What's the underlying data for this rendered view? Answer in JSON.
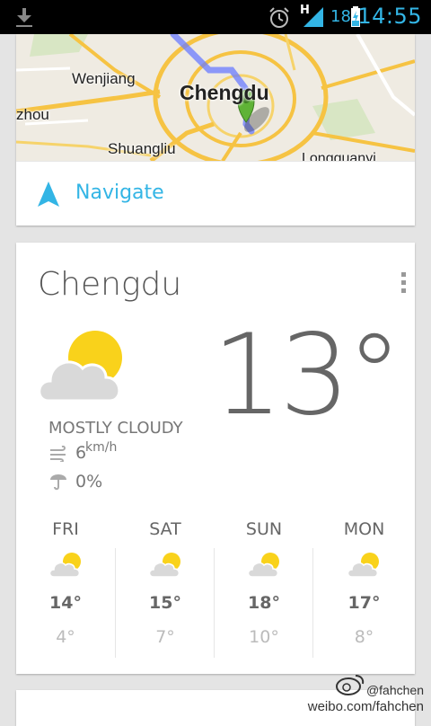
{
  "status_bar": {
    "network": "H",
    "battery": "18",
    "time": "14:55"
  },
  "map": {
    "labels": [
      "Wenjiang",
      "Chengdu",
      "zhou",
      "Shuangliu",
      "Longquanyi"
    ]
  },
  "navigate": {
    "label": "Navigate"
  },
  "weather": {
    "city": "Chengdu",
    "temperature": "13°",
    "condition": "MOSTLY CLOUDY",
    "wind_value": "6",
    "wind_unit": "km/h",
    "precipitation": "0%",
    "forecast": [
      {
        "day": "FRI",
        "high": "14°",
        "low": "4°"
      },
      {
        "day": "SAT",
        "high": "15°",
        "low": "7°"
      },
      {
        "day": "SUN",
        "high": "18°",
        "low": "10°"
      },
      {
        "day": "MON",
        "high": "17°",
        "low": "8°"
      }
    ]
  },
  "watermark": {
    "handle": "@fahchen",
    "url": "weibo.com/fahchen"
  },
  "icons": {
    "download": "download-icon",
    "alarm": "alarm-clock-icon",
    "signal": "signal-icon",
    "battery": "battery-charging-icon",
    "navigate": "navigate-arrow-icon",
    "menu": "overflow-menu-icon",
    "weather": "partly-cloudy-icon",
    "wind": "wind-icon",
    "umbrella": "umbrella-icon"
  },
  "colors": {
    "accent": "#33b5e5",
    "sun": "#f9d21b",
    "cloud": "#d9d9d9"
  }
}
